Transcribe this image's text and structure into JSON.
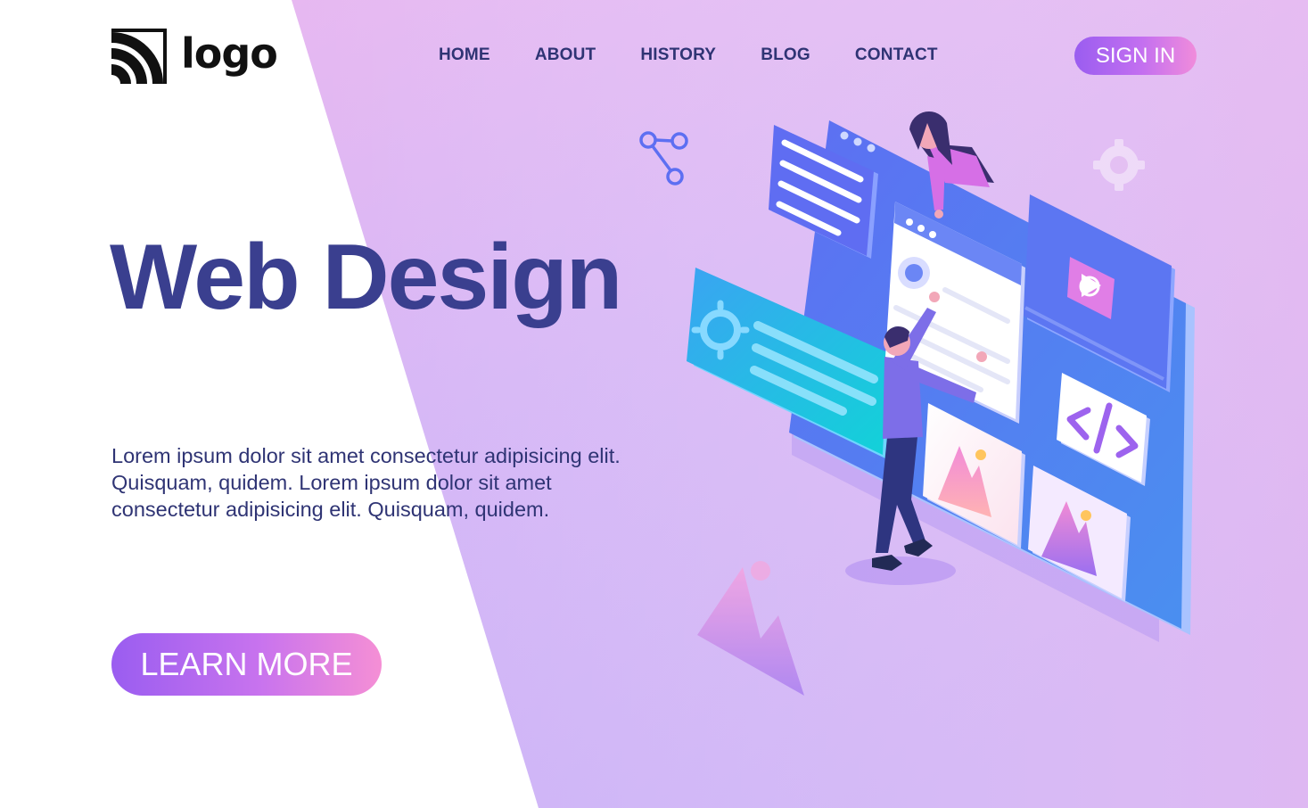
{
  "header": {
    "logo_text": "logo",
    "nav": [
      {
        "label": "HOME"
      },
      {
        "label": "ABOUT"
      },
      {
        "label": "HISTORY"
      },
      {
        "label": "BLOG"
      },
      {
        "label": "CONTACT"
      }
    ],
    "signin_label": "SIGN IN"
  },
  "hero": {
    "title": "Web Design",
    "description": "Lorem ipsum dolor sit amet consectetur adipisicing elit. Quisquam, quidem. Lorem ipsum dolor sit amet consectetur adipisicing elit. Quisquam, quidem.",
    "cta_label": "LEARN MORE"
  },
  "colors": {
    "title": "#3a3f8f",
    "nav_text": "#2f3474",
    "gradient_start": "#9a5df0",
    "gradient_end": "#f58fd5",
    "bg_purple": "#c9b0f5",
    "bg_pink": "#f8c6ee"
  },
  "icons": [
    "logo-wifi-mark-icon",
    "share-icon",
    "gear-icon",
    "code-icon",
    "image-icon",
    "play-icon",
    "mountain-decoration-icon"
  ]
}
